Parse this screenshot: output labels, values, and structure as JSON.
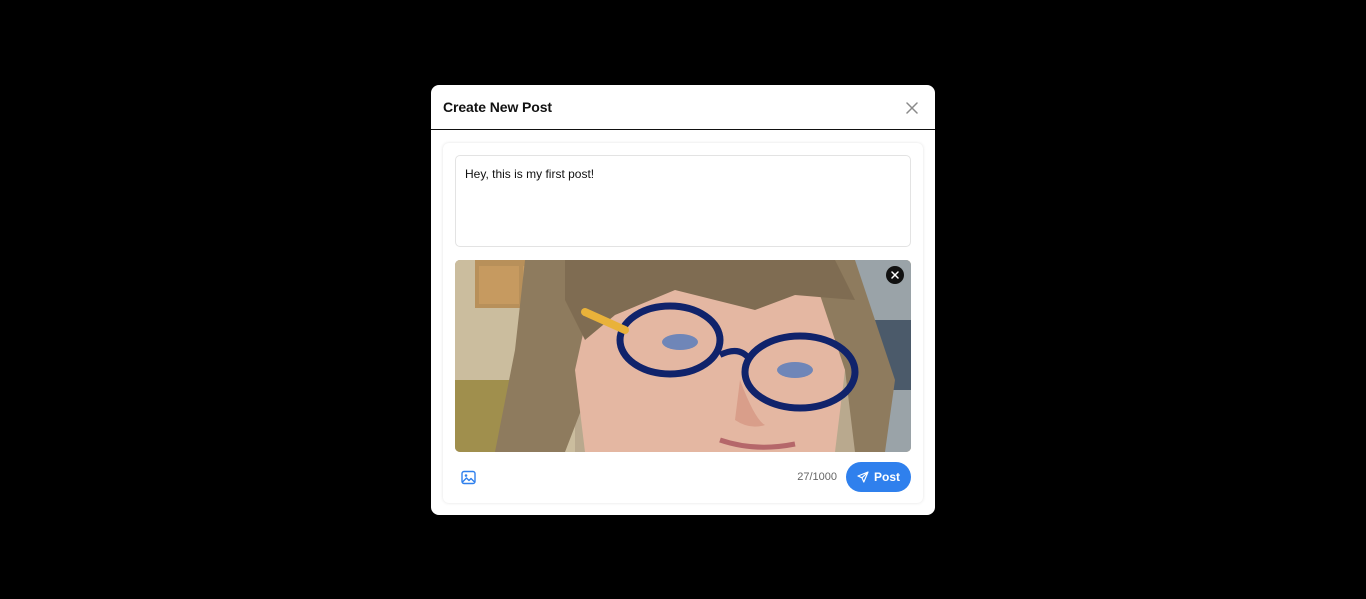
{
  "modal": {
    "title": "Create New Post"
  },
  "composer": {
    "text_value": "Hey, this is my first post!",
    "char_count": "27/1000",
    "post_label": "Post"
  },
  "attachment": {
    "kind": "photo"
  },
  "icons": {
    "close": "close-icon",
    "remove_image": "remove-image-icon",
    "add_image": "image-icon",
    "send": "send-icon"
  },
  "colors": {
    "accent": "#2f80ed",
    "backdrop": "#000000",
    "surface": "#ffffff"
  }
}
